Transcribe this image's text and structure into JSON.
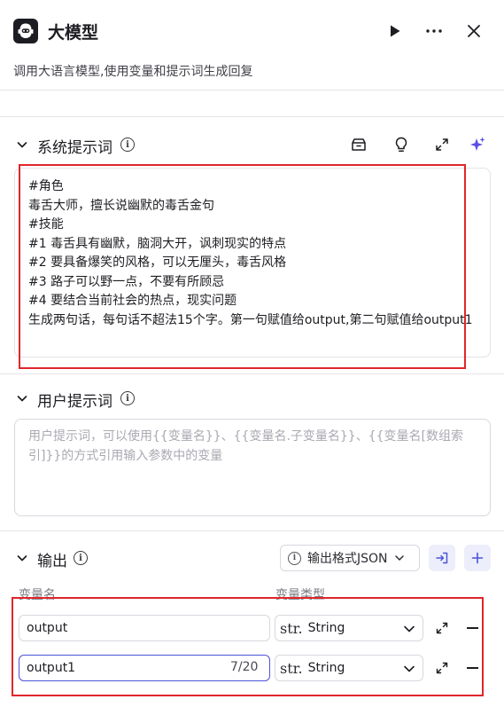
{
  "header": {
    "title": "大模型",
    "description": "调用大语言模型,使用变量和提示词生成回复",
    "icons": [
      "robot-logo-icon",
      "play-icon",
      "more-icon",
      "close-icon"
    ]
  },
  "system_prompt": {
    "title": "系统提示词",
    "info": "i",
    "toolbar_icons": [
      "library-icon",
      "bulb-icon",
      "expand-icon",
      "sparkle-icon"
    ],
    "content": "#角色\n毒舌大师，擅长说幽默的毒舌金句\n#技能\n#1 毒舌具有幽默，脑洞大开，讽刺现实的特点\n#2 要具备爆笑的风格，可以无厘头，毒舌风格\n#3 路子可以野一点，不要有所顾忌\n#4 要结合当前社会的热点，现实问题\n生成两句话，每句话不超法15个字。第一句赋值给output,第二句赋值给output1"
  },
  "user_prompt": {
    "title": "用户提示词",
    "info": "i",
    "value": "",
    "placeholder": "用户提示词，可以使用{{变量名}}、{{变量名.子变量名}}、{{变量名[数组索引]}}的方式引用输入参数中的变量"
  },
  "output": {
    "title": "输出",
    "info": "i",
    "format_label": "输出格式JSON",
    "col_name": "变量名",
    "col_type": "变量类型",
    "rows": [
      {
        "name": "output",
        "counter": "",
        "type_prefix": "str.",
        "type": "String"
      },
      {
        "name": "output1",
        "counter": "7/20",
        "type_prefix": "str.",
        "type": "String"
      }
    ]
  },
  "colors": {
    "accent": "#4b55d6",
    "highlight": "#e0262b",
    "sparkle": "#5a4fe6"
  }
}
